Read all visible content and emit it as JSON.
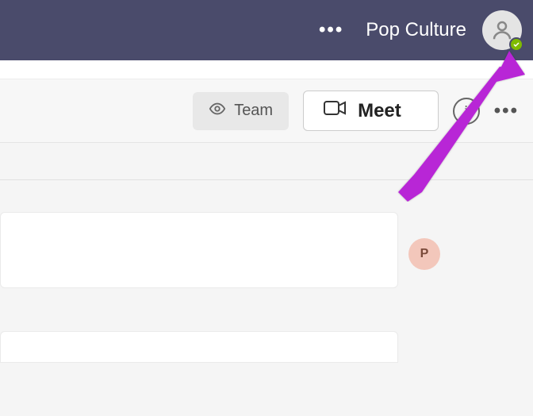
{
  "header": {
    "title": "Pop Culture",
    "more_label": "•••",
    "presence_status": "available"
  },
  "toolbar": {
    "team_label": "Team",
    "meet_label": "Meet",
    "info_label": "i",
    "more_label": "•••"
  },
  "participants": [
    {
      "initial": "P"
    }
  ],
  "colors": {
    "header_bg": "#4a4b6b",
    "presence": "#7fba00",
    "arrow": "#b827d6",
    "participant_chip": "#f3c7bb"
  }
}
